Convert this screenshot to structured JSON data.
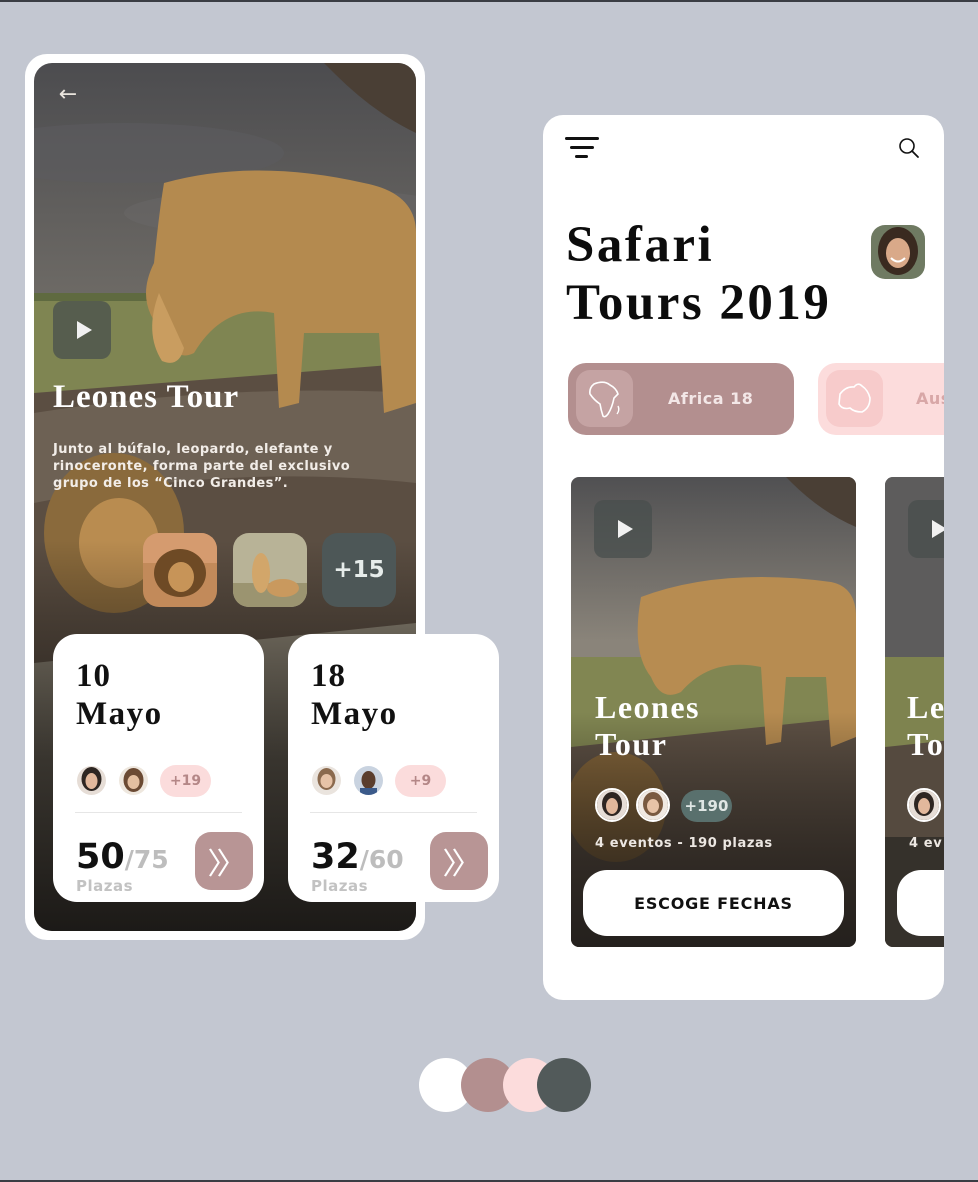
{
  "left_screen": {
    "title": "Leones Tour",
    "description": "Junto al búfalo, leopardo, elefante y rinoceronte, forma parte del exclusivo grupo de los “Cinco Grandes”.",
    "more_photos": "+15",
    "back_icon": "arrow-left-icon",
    "play_icon": "play-icon"
  },
  "dates": [
    {
      "day": "10",
      "month": "Mayo",
      "extra": "+19",
      "seats_taken": "50",
      "seats_total": "/75",
      "seats_label": "Plazas"
    },
    {
      "day": "18",
      "month": "Mayo",
      "extra": "+9",
      "seats_taken": "32",
      "seats_total": "/60",
      "seats_label": "Plazas"
    }
  ],
  "right_screen": {
    "title_line1": "Safari",
    "title_line2": "Tours 2019",
    "regions": [
      {
        "label": "Africa 18",
        "active": true
      },
      {
        "label": "Aus",
        "active": false
      }
    ],
    "tours": [
      {
        "title_line1": "Leones",
        "title_line2": "Tour",
        "count": "+190",
        "meta": "4 eventos - 190 plazas",
        "button": "ESCOGE FECHAS"
      },
      {
        "title_line1": "Le",
        "title_line2": "To",
        "meta": "4 ev"
      }
    ]
  },
  "palette": [
    "#ffffff",
    "#b38f8f",
    "#fcdcdc",
    "#525a5a"
  ]
}
